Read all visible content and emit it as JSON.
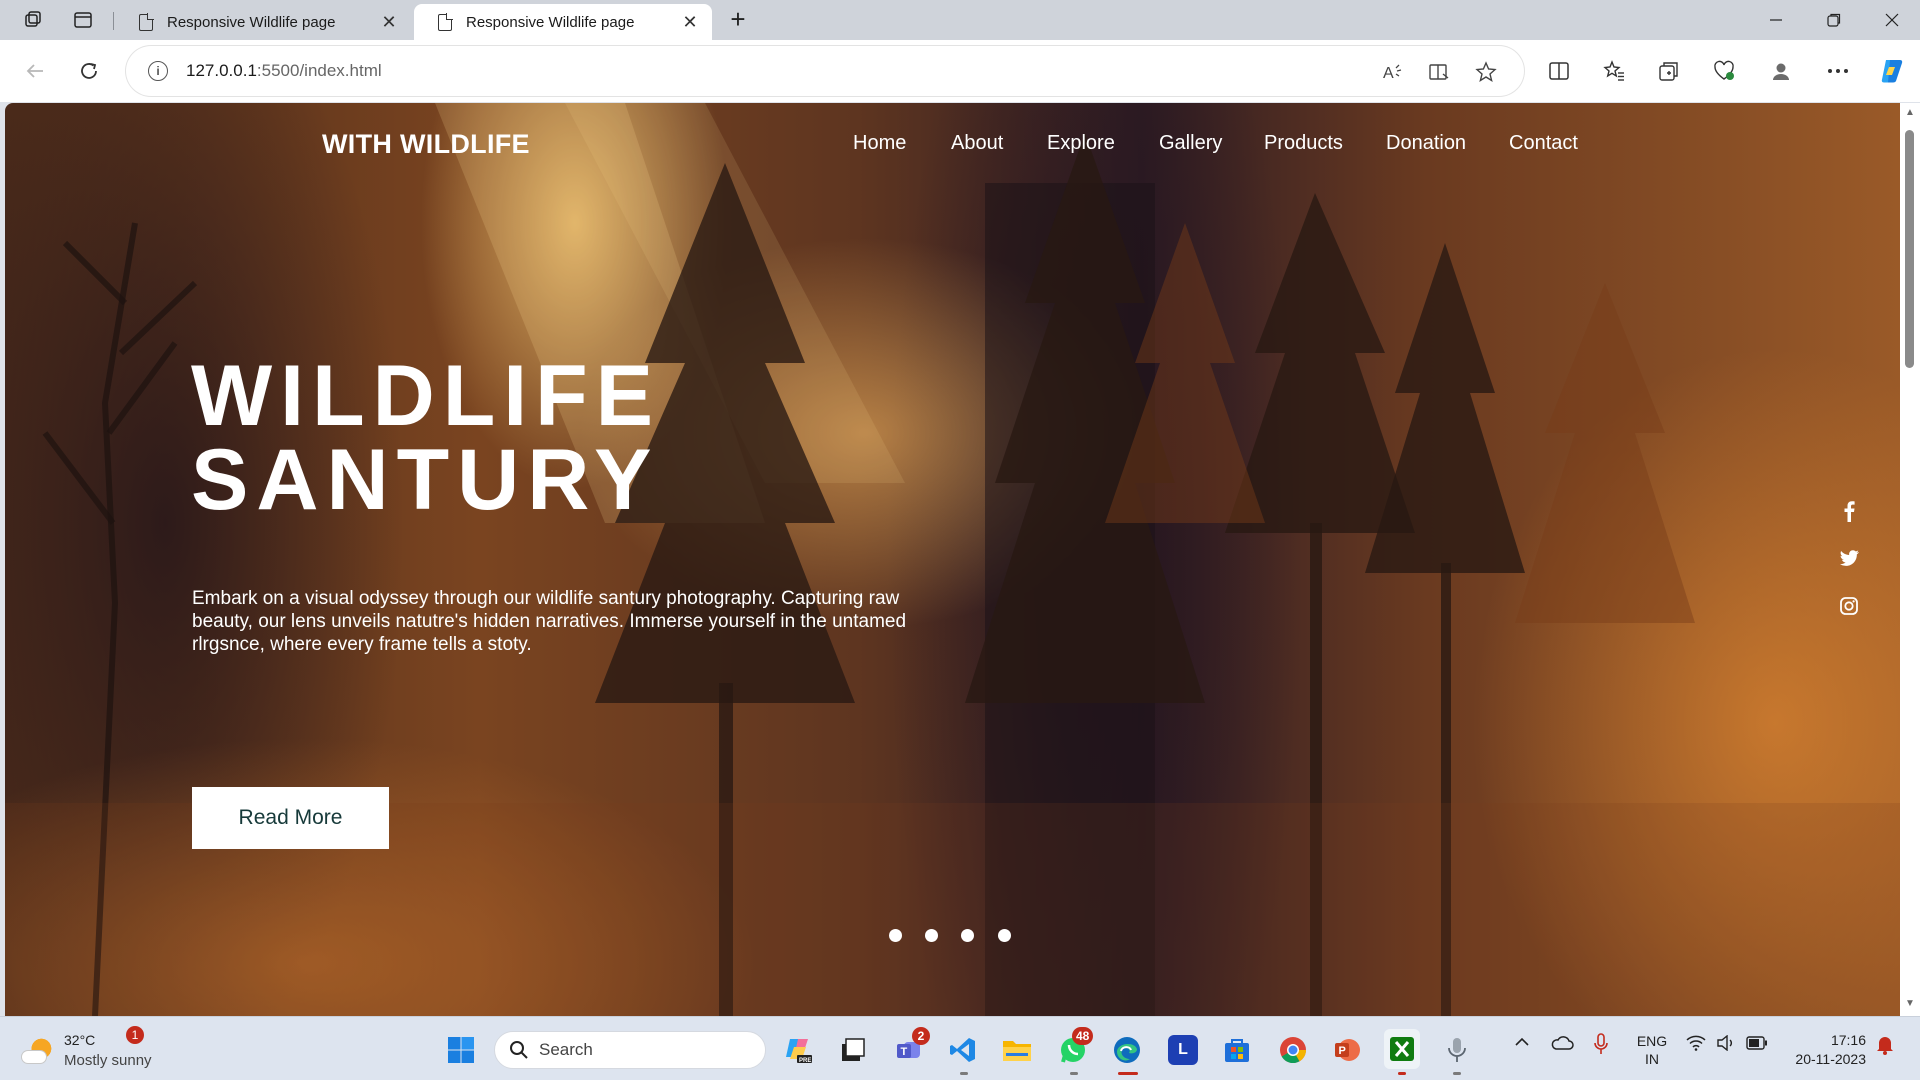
{
  "browser": {
    "tabs": [
      {
        "title": "Responsive Wildlife page",
        "active": false
      },
      {
        "title": "Responsive Wildlife page",
        "active": true
      }
    ],
    "url_host": "127.0.0.1",
    "url_rest": ":5500/index.html"
  },
  "page": {
    "brand": "WITH WILDLIFE",
    "nav": [
      "Home",
      "About",
      "Explore",
      "Gallery",
      "Products",
      "Donation",
      "Contact"
    ],
    "hero_title_line1": "WILDLIFE",
    "hero_title_line2": "SANTURY",
    "hero_text": "Embark on a visual odyssey through our wildlife santury photography. Capturing raw beauty, our lens unveils natutre's hidden narratives. Immerse yourself in the untamed rlrgsnce, where every frame tells a stoty.",
    "read_more": "Read More",
    "social_icons": [
      "facebook-icon",
      "twitter-icon",
      "instagram-icon"
    ],
    "slider_dots": 4
  },
  "taskbar": {
    "weather_temp": "32°C",
    "weather_desc": "Mostly sunny",
    "weather_badge": "1",
    "search_label": "Search",
    "teams_badge": "2",
    "whatsapp_badge": "48",
    "lang_line1": "ENG",
    "lang_line2": "IN",
    "time": "17:16",
    "date": "20-11-2023"
  },
  "colors": {
    "button_text": "#173a3a",
    "accent_edge": "#0f6cbd"
  }
}
